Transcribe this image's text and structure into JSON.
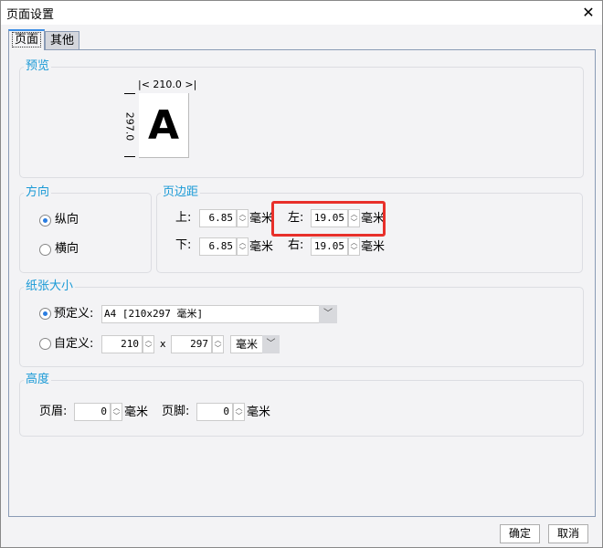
{
  "window": {
    "title": "页面设置",
    "close_icon": "close-icon"
  },
  "tabs": [
    {
      "label": "页面",
      "active": true
    },
    {
      "label": "其他",
      "active": false
    }
  ],
  "preview": {
    "label": "预览",
    "width_text": "210.0",
    "height_text": "297.0",
    "letter": "A"
  },
  "orientation": {
    "label": "方向",
    "options": [
      {
        "label": "纵向",
        "selected": true
      },
      {
        "label": "横向",
        "selected": false
      }
    ]
  },
  "margins": {
    "label": "页边距",
    "top": {
      "label": "上:",
      "value": "6.85",
      "unit": "毫米"
    },
    "bottom": {
      "label": "下:",
      "value": "6.85",
      "unit": "毫米"
    },
    "left": {
      "label": "左:",
      "value": "19.05",
      "unit": "毫米"
    },
    "right": {
      "label": "右:",
      "value": "19.05",
      "unit": "毫米"
    },
    "highlight_color": "#e8302a"
  },
  "paper": {
    "label": "纸张大小",
    "predefined": {
      "label": "预定义:",
      "value": "A4 [210x297 毫米]",
      "selected": true
    },
    "custom": {
      "label": "自定义:",
      "width": "210",
      "x": "x",
      "height": "297",
      "unit": "毫米",
      "selected": false
    }
  },
  "height": {
    "label": "高度",
    "header": {
      "label": "页眉:",
      "value": "0",
      "unit": "毫米"
    },
    "footer": {
      "label": "页脚:",
      "value": "0",
      "unit": "毫米"
    }
  },
  "buttons": {
    "ok": "确定",
    "cancel": "取消"
  }
}
